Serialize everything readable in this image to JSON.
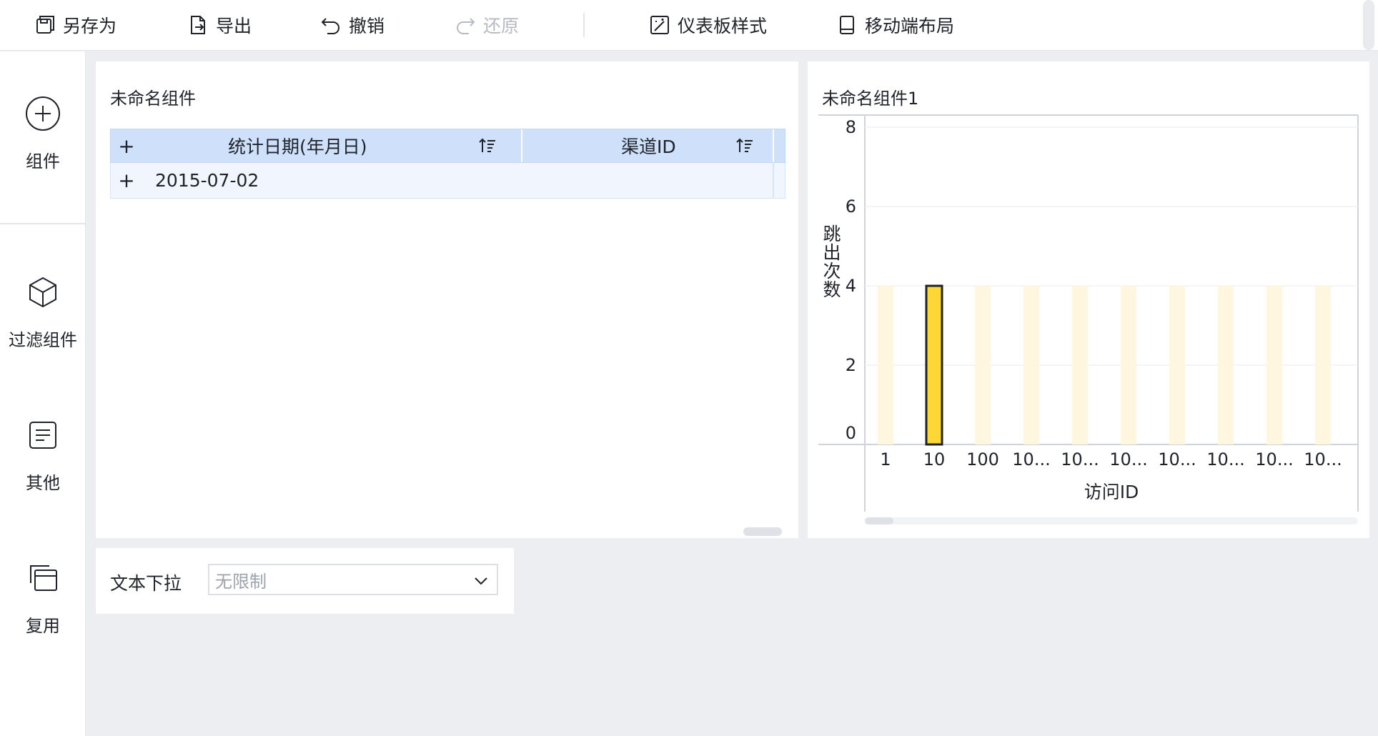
{
  "toolbar": {
    "save_as": "另存为",
    "export": "导出",
    "undo": "撤销",
    "redo": "还原",
    "dashboard_style": "仪表板样式",
    "mobile_layout": "移动端布局"
  },
  "sidebar": {
    "items": [
      {
        "label": "组件",
        "icon": "plus-circle-icon"
      },
      {
        "label": "过滤组件",
        "icon": "cube-icon"
      },
      {
        "label": "其他",
        "icon": "text-doc-icon"
      },
      {
        "label": "复用",
        "icon": "copy-window-icon"
      }
    ]
  },
  "table_widget": {
    "title": "未命名组件",
    "columns": [
      "统计日期(年月日)",
      "渠道ID"
    ],
    "rows": [
      [
        "2015-07-02",
        ""
      ]
    ]
  },
  "chart_widget": {
    "title": "未命名组件1"
  },
  "filter_widget": {
    "label": "文本下拉",
    "placeholder": "无限制"
  },
  "colors": {
    "accent_bar": "#fdd835",
    "faded_bar": "#fff6e0",
    "table_header": "#cfe0fb"
  },
  "chart_data": {
    "type": "bar",
    "title": "",
    "xlabel": "访问ID",
    "ylabel": "跳出次数",
    "categories": [
      "1",
      "10",
      "100",
      "10...",
      "10...",
      "10...",
      "10...",
      "10...",
      "10...",
      "10..."
    ],
    "values": [
      4,
      4,
      4,
      4,
      4,
      4,
      4,
      4,
      4,
      4
    ],
    "highlighted_index": 1,
    "yticks": [
      0,
      2,
      4,
      6,
      8
    ],
    "ylim": [
      0,
      8
    ],
    "grid": true,
    "legend": "none"
  }
}
